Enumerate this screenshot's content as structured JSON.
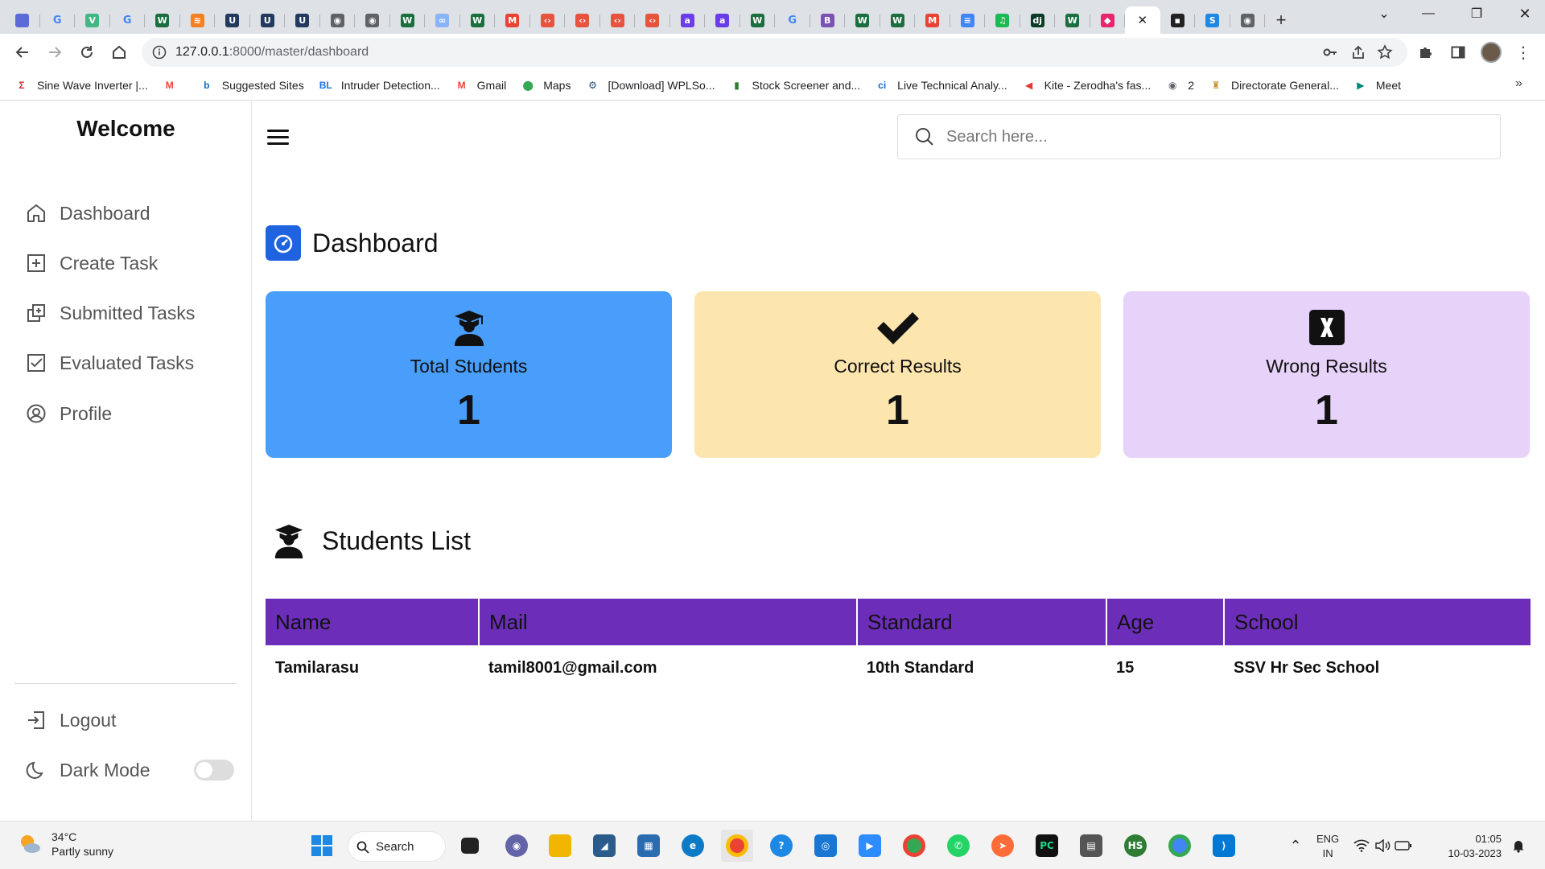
{
  "browser": {
    "url_host": "127.0.0.1",
    "url_rest": ":8000/master/dashboard",
    "tabs": [
      {
        "icon": "copilot-tab-icon",
        "color": "#5b6bd8",
        "glyph": ""
      },
      {
        "icon": "google-tab-icon",
        "color": "#ffffff",
        "glyph": "G"
      },
      {
        "icon": "vue-tab-icon",
        "color": "#41b883",
        "glyph": "V"
      },
      {
        "icon": "google-tab-icon",
        "color": "#ffffff",
        "glyph": "G"
      },
      {
        "icon": "w-tab-icon",
        "color": "#1b6e3e",
        "glyph": "W"
      },
      {
        "icon": "stack-tab-icon",
        "color": "#f48024",
        "glyph": "≋"
      },
      {
        "icon": "u-tab-icon",
        "color": "#233a5e",
        "glyph": "U"
      },
      {
        "icon": "u-tab-icon",
        "color": "#233a5e",
        "glyph": "U"
      },
      {
        "icon": "u-tab-icon",
        "color": "#233a5e",
        "glyph": "U"
      },
      {
        "icon": "globe-tab-icon",
        "color": "#5f6368",
        "glyph": "◉"
      },
      {
        "icon": "globe-tab-icon",
        "color": "#5f6368",
        "glyph": "◉"
      },
      {
        "icon": "w-tab-icon",
        "color": "#1b6e3e",
        "glyph": "W"
      },
      {
        "icon": "cloud-tab-icon",
        "color": "#8ab4f8",
        "glyph": "∞"
      },
      {
        "icon": "w-tab-icon",
        "color": "#1b6e3e",
        "glyph": "W"
      },
      {
        "icon": "gmail-tab-icon",
        "color": "#ea4335",
        "glyph": "M"
      },
      {
        "icon": "code-tab-icon",
        "color": "#e8533f",
        "glyph": "‹›"
      },
      {
        "icon": "code-tab-icon",
        "color": "#e8533f",
        "glyph": "‹›"
      },
      {
        "icon": "code-tab-icon",
        "color": "#e8533f",
        "glyph": "‹›"
      },
      {
        "icon": "code-tab-icon",
        "color": "#e8533f",
        "glyph": "‹›"
      },
      {
        "icon": "a-tab-icon",
        "color": "#6a3de8",
        "glyph": "a"
      },
      {
        "icon": "a-tab-icon",
        "color": "#6a3de8",
        "glyph": "a"
      },
      {
        "icon": "w-tab-icon",
        "color": "#1b6e3e",
        "glyph": "W"
      },
      {
        "icon": "google-tab-icon",
        "color": "#ffffff",
        "glyph": "G"
      },
      {
        "icon": "bootstrap-tab-icon",
        "color": "#7952b3",
        "glyph": "B"
      },
      {
        "icon": "w-tab-icon",
        "color": "#1b6e3e",
        "glyph": "W"
      },
      {
        "icon": "w-tab-icon",
        "color": "#1b6e3e",
        "glyph": "W"
      },
      {
        "icon": "gmail-tab-icon",
        "color": "#ea4335",
        "glyph": "M"
      },
      {
        "icon": "docs-tab-icon",
        "color": "#4285f4",
        "glyph": "≡"
      },
      {
        "icon": "spotify-tab-icon",
        "color": "#1db954",
        "glyph": "♫"
      },
      {
        "icon": "django-tab-icon",
        "color": "#0c3c26",
        "glyph": "dj"
      },
      {
        "icon": "w-tab-icon",
        "color": "#1b6e3e",
        "glyph": "W"
      },
      {
        "icon": "cube-tab-icon",
        "color": "#e8266f",
        "glyph": "◆"
      },
      {
        "icon": "active-tab-close-icon",
        "color": "#ffffff",
        "glyph": "✕",
        "active": true
      },
      {
        "icon": "dark-tab-icon",
        "color": "#222222",
        "glyph": "▪"
      },
      {
        "icon": "blue-tab-icon",
        "color": "#1e88e5",
        "glyph": "S"
      },
      {
        "icon": "globe-tab-icon",
        "color": "#5f6368",
        "glyph": "◉"
      }
    ],
    "bookmarks": [
      {
        "label": "Sine Wave Inverter |...",
        "icon": "sigma-icon",
        "color": "#d32f2f",
        "glyph": "Σ"
      },
      {
        "label": "",
        "icon": "gmail-icon",
        "color": "#ea4335",
        "glyph": "M"
      },
      {
        "label": "Suggested Sites",
        "icon": "bing-icon",
        "color": "#0f6cbd",
        "glyph": "b"
      },
      {
        "label": "Intruder Detection...",
        "icon": "bl-icon",
        "color": "#1a73e8",
        "glyph": "BL"
      },
      {
        "label": "Gmail",
        "icon": "gmail-icon",
        "color": "#ea4335",
        "glyph": "M"
      },
      {
        "label": "Maps",
        "icon": "maps-icon",
        "color": "#34a853",
        "glyph": "⬤"
      },
      {
        "label": "[Download] WPLSo...",
        "icon": "gear-icon",
        "color": "#1f4e79",
        "glyph": "⚙"
      },
      {
        "label": "Stock Screener and...",
        "icon": "chart-icon",
        "color": "#2e7d32",
        "glyph": "▮"
      },
      {
        "label": "Live Technical Analy...",
        "icon": "ci-icon",
        "color": "#1565c0",
        "glyph": "ci"
      },
      {
        "label": "Kite - Zerodha's fas...",
        "icon": "kite-icon",
        "color": "#e53935",
        "glyph": "◀"
      },
      {
        "label": "2",
        "icon": "globe-icon",
        "color": "#5f6368",
        "glyph": "◉"
      },
      {
        "label": "Directorate General...",
        "icon": "emblem-icon",
        "color": "#c8902a",
        "glyph": "♜"
      },
      {
        "label": "Meet",
        "icon": "meet-icon",
        "color": "#00897b",
        "glyph": "▶"
      }
    ]
  },
  "sidebar": {
    "brand": "Welcome",
    "items": [
      {
        "label": "Dashboard",
        "icon": "home-icon"
      },
      {
        "label": "Create Task",
        "icon": "plus-square-icon"
      },
      {
        "label": "Submitted Tasks",
        "icon": "copy-icon"
      },
      {
        "label": "Evaluated Tasks",
        "icon": "check-square-icon"
      },
      {
        "label": "Profile",
        "icon": "user-circle-icon"
      }
    ],
    "logout_label": "Logout",
    "dark_mode_label": "Dark Mode",
    "dark_mode_on": false
  },
  "header": {
    "search_placeholder": "Search here..."
  },
  "dashboard": {
    "title": "Dashboard",
    "cards": [
      {
        "label": "Total Students",
        "value": "1",
        "color": "#4a9efb",
        "icon": "graduate-icon"
      },
      {
        "label": "Correct Results",
        "value": "1",
        "color": "#fde5ae",
        "icon": "checkmark-icon"
      },
      {
        "label": "Wrong Results",
        "value": "1",
        "color": "#e7d3fa",
        "icon": "x-square-icon"
      }
    ]
  },
  "students": {
    "title": "Students List",
    "header_color": "#6c2eb9",
    "columns": [
      "Name",
      "Mail",
      "Standard",
      "Age",
      "School"
    ],
    "rows": [
      [
        "Tamilarasu",
        "tamil8001@gmail.com",
        "10th Standard",
        "15",
        "SSV Hr Sec School"
      ]
    ]
  },
  "taskbar": {
    "temperature": "34°C",
    "weather": "Partly sunny",
    "search_label": "Search",
    "lang_1": "ENG",
    "lang_2": "IN",
    "time": "01:05",
    "date": "10-03-2023"
  }
}
